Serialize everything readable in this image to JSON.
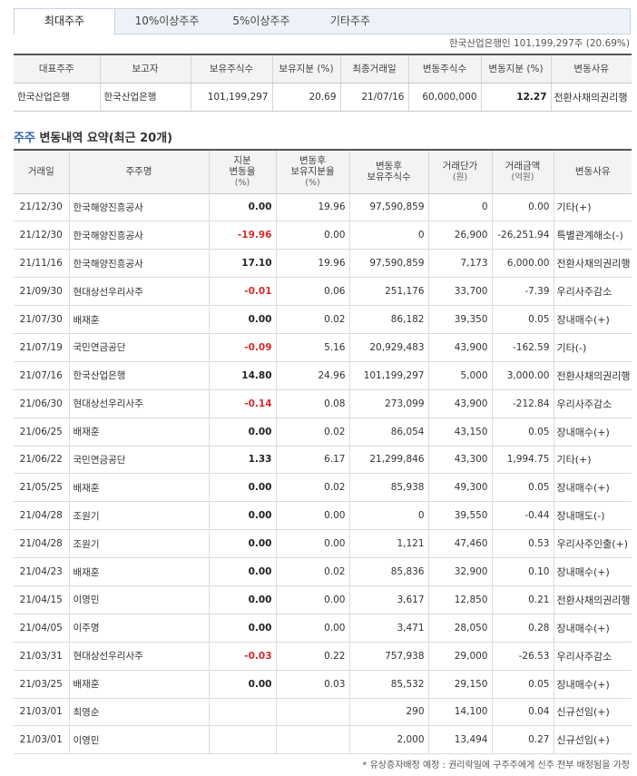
{
  "tabs": [
    {
      "label": "최대주주"
    },
    {
      "label": "10%이상주주"
    },
    {
      "label": "5%이상주주"
    },
    {
      "label": "기타주주"
    }
  ],
  "holding_info": "한국산업은행인 101,199,297주 (20.69%)",
  "summary": {
    "headers": [
      "대표주주",
      "보고자",
      "보유주식수",
      "보유지분 (%)",
      "최종거래일",
      "변동주식수",
      "변동지분 (%)",
      "변동사유"
    ],
    "row": {
      "representative": "한국산업은행",
      "reporter": "한국산업은행",
      "shares": "101,199,297",
      "stake": "20.69",
      "last_date": "21/07/16",
      "change_shares": "60,000,000",
      "change_stake": "12.27",
      "reason": "전환사채의권리행"
    }
  },
  "section": {
    "title_blue": "주주",
    "title_rest": " 변동내역 요약(최근 20개)"
  },
  "history": {
    "headers": {
      "date": "거래일",
      "holder": "주주명",
      "stake_change_1": "지분",
      "stake_change_2": "변동율",
      "stake_change_unit": "(%)",
      "after_stake_1": "변동후",
      "after_stake_2": "보유지분율",
      "after_stake_unit": "(%)",
      "after_shares_1": "변동후",
      "after_shares_2": "보유주식수",
      "price_1": "거래단가",
      "price_unit": "(원)",
      "amount_1": "거래금액",
      "amount_unit": "(억원)",
      "reason": "변동사유"
    },
    "rows": [
      {
        "date": "21/12/30",
        "holder": "한국해양진흥공사",
        "change": "0.00",
        "neg": false,
        "after_stake": "19.96",
        "after_shares": "97,590,859",
        "price": "0",
        "amount": "0.00",
        "reason": "기타(+)"
      },
      {
        "date": "21/12/30",
        "holder": "한국해양진흥공사",
        "change": "-19.96",
        "neg": true,
        "after_stake": "0.00",
        "after_shares": "0",
        "price": "26,900",
        "amount": "-26,251.94",
        "reason": "특별관계해소(-)"
      },
      {
        "date": "21/11/16",
        "holder": "한국해양진흥공사",
        "change": "17.10",
        "neg": false,
        "after_stake": "19.96",
        "after_shares": "97,590,859",
        "price": "7,173",
        "amount": "6,000.00",
        "reason": "전환사채의권리행"
      },
      {
        "date": "21/09/30",
        "holder": "현대상선우리사주",
        "change": "-0.01",
        "neg": true,
        "after_stake": "0.06",
        "after_shares": "251,176",
        "price": "33,700",
        "amount": "-7.39",
        "reason": "우리사주감소"
      },
      {
        "date": "21/07/30",
        "holder": "배재훈",
        "change": "0.00",
        "neg": false,
        "after_stake": "0.02",
        "after_shares": "86,182",
        "price": "39,350",
        "amount": "0.05",
        "reason": "장내매수(+)"
      },
      {
        "date": "21/07/19",
        "holder": "국민연금공단",
        "change": "-0.09",
        "neg": true,
        "after_stake": "5.16",
        "after_shares": "20,929,483",
        "price": "43,900",
        "amount": "-162.59",
        "reason": "기타(-)"
      },
      {
        "date": "21/07/16",
        "holder": "한국산업은행",
        "change": "14.80",
        "neg": false,
        "after_stake": "24.96",
        "after_shares": "101,199,297",
        "price": "5,000",
        "amount": "3,000.00",
        "reason": "전환사채의권리행"
      },
      {
        "date": "21/06/30",
        "holder": "현대상선우리사주",
        "change": "-0.14",
        "neg": true,
        "after_stake": "0.08",
        "after_shares": "273,099",
        "price": "43,900",
        "amount": "-212.84",
        "reason": "우리사주감소"
      },
      {
        "date": "21/06/25",
        "holder": "배재훈",
        "change": "0.00",
        "neg": false,
        "after_stake": "0.02",
        "after_shares": "86,054",
        "price": "43,150",
        "amount": "0.05",
        "reason": "장내매수(+)"
      },
      {
        "date": "21/06/22",
        "holder": "국민연금공단",
        "change": "1.33",
        "neg": false,
        "after_stake": "6.17",
        "after_shares": "21,299,846",
        "price": "43,300",
        "amount": "1,994.75",
        "reason": "기타(+)"
      },
      {
        "date": "21/05/25",
        "holder": "배재훈",
        "change": "0.00",
        "neg": false,
        "after_stake": "0.02",
        "after_shares": "85,938",
        "price": "49,300",
        "amount": "0.05",
        "reason": "장내매수(+)"
      },
      {
        "date": "21/04/28",
        "holder": "조원기",
        "change": "0.00",
        "neg": false,
        "after_stake": "0.00",
        "after_shares": "0",
        "price": "39,550",
        "amount": "-0.44",
        "reason": "장내매도(-)"
      },
      {
        "date": "21/04/28",
        "holder": "조원기",
        "change": "0.00",
        "neg": false,
        "after_stake": "0.00",
        "after_shares": "1,121",
        "price": "47,460",
        "amount": "0.53",
        "reason": "우리사주인출(+)"
      },
      {
        "date": "21/04/23",
        "holder": "배재훈",
        "change": "0.00",
        "neg": false,
        "after_stake": "0.02",
        "after_shares": "85,836",
        "price": "32,900",
        "amount": "0.10",
        "reason": "장내매수(+)"
      },
      {
        "date": "21/04/15",
        "holder": "이영민",
        "change": "0.00",
        "neg": false,
        "after_stake": "0.00",
        "after_shares": "3,617",
        "price": "12,850",
        "amount": "0.21",
        "reason": "전환사채의권리행"
      },
      {
        "date": "21/04/05",
        "holder": "이주명",
        "change": "0.00",
        "neg": false,
        "after_stake": "0.00",
        "after_shares": "3,471",
        "price": "28,050",
        "amount": "0.28",
        "reason": "장내매수(+)"
      },
      {
        "date": "21/03/31",
        "holder": "현대상선우리사주",
        "change": "-0.03",
        "neg": true,
        "after_stake": "0.22",
        "after_shares": "757,938",
        "price": "29,000",
        "amount": "-26.53",
        "reason": "우리사주감소"
      },
      {
        "date": "21/03/25",
        "holder": "배재훈",
        "change": "0.00",
        "neg": false,
        "after_stake": "0.03",
        "after_shares": "85,532",
        "price": "29,150",
        "amount": "0.05",
        "reason": "장내매수(+)"
      },
      {
        "date": "21/03/01",
        "holder": "최영순",
        "change": "",
        "neg": false,
        "after_stake": "",
        "after_shares": "290",
        "price": "14,100",
        "amount": "0.04",
        "reason": "신규선임(+)"
      },
      {
        "date": "21/03/01",
        "holder": "이영민",
        "change": "",
        "neg": false,
        "after_stake": "",
        "after_shares": "2,000",
        "price": "13,494",
        "amount": "0.27",
        "reason": "신규선임(+)"
      }
    ]
  },
  "footnote": "* 유상증자배정 예정 : 권리락일에 구주주에게 신주 전부 배정됨을 가정"
}
